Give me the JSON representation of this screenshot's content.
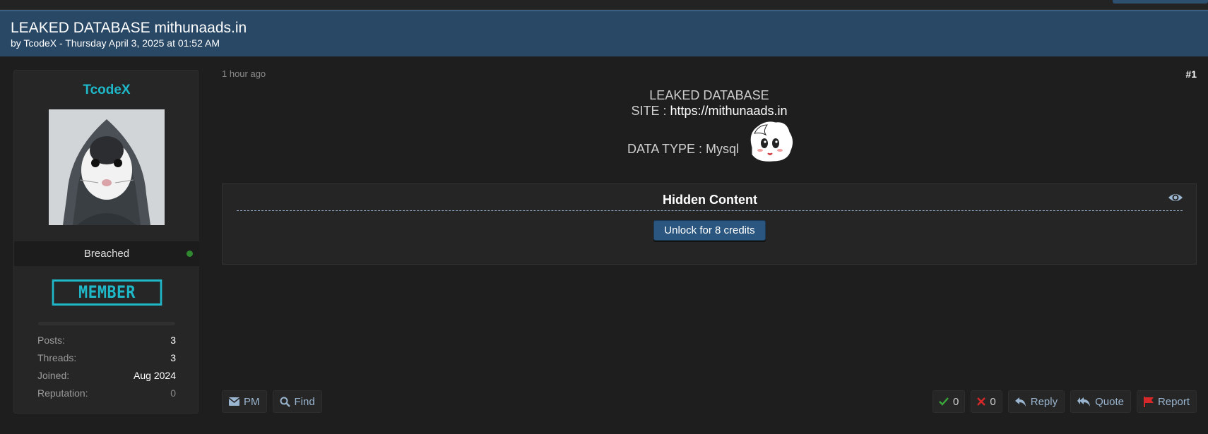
{
  "thread": {
    "title": "LEAKED DATABASE mithunaads.in",
    "byline": "by TcodeX - Thursday April 3, 2025 at 01:52 AM"
  },
  "author": {
    "username": "TcodeX",
    "status": "Breached",
    "online": true,
    "rank_badge": "MEMBER",
    "stats": [
      {
        "label": "Posts:",
        "value": "3"
      },
      {
        "label": "Threads:",
        "value": "3"
      },
      {
        "label": "Joined:",
        "value": "Aug 2024"
      },
      {
        "label": "Reputation:",
        "value": "0"
      }
    ]
  },
  "post": {
    "time_ago": "1 hour ago",
    "number": "#1",
    "line1": "LEAKED DATABASE",
    "site_label": "SITE : ",
    "site_url": "https://mithunaads.in",
    "data_type": "DATA TYPE : Mysql",
    "hidden_title": "Hidden Content",
    "unlock_label": "Unlock for 8 credits"
  },
  "actions": {
    "pm": "PM",
    "find": "Find",
    "upvotes": "0",
    "downvotes": "0",
    "reply": "Reply",
    "quote": "Quote",
    "report": "Report"
  },
  "colors": {
    "accent": "#1fb8c9",
    "header_bg": "#284866",
    "online": "#2f8a2f",
    "report": "#d62828",
    "upvote": "#3aa83a",
    "downvote": "#d62828"
  },
  "icons": [
    "eye-icon",
    "envelope-icon",
    "search-icon",
    "check-icon",
    "x-icon",
    "reply-icon",
    "quote-icon",
    "flag-icon"
  ]
}
